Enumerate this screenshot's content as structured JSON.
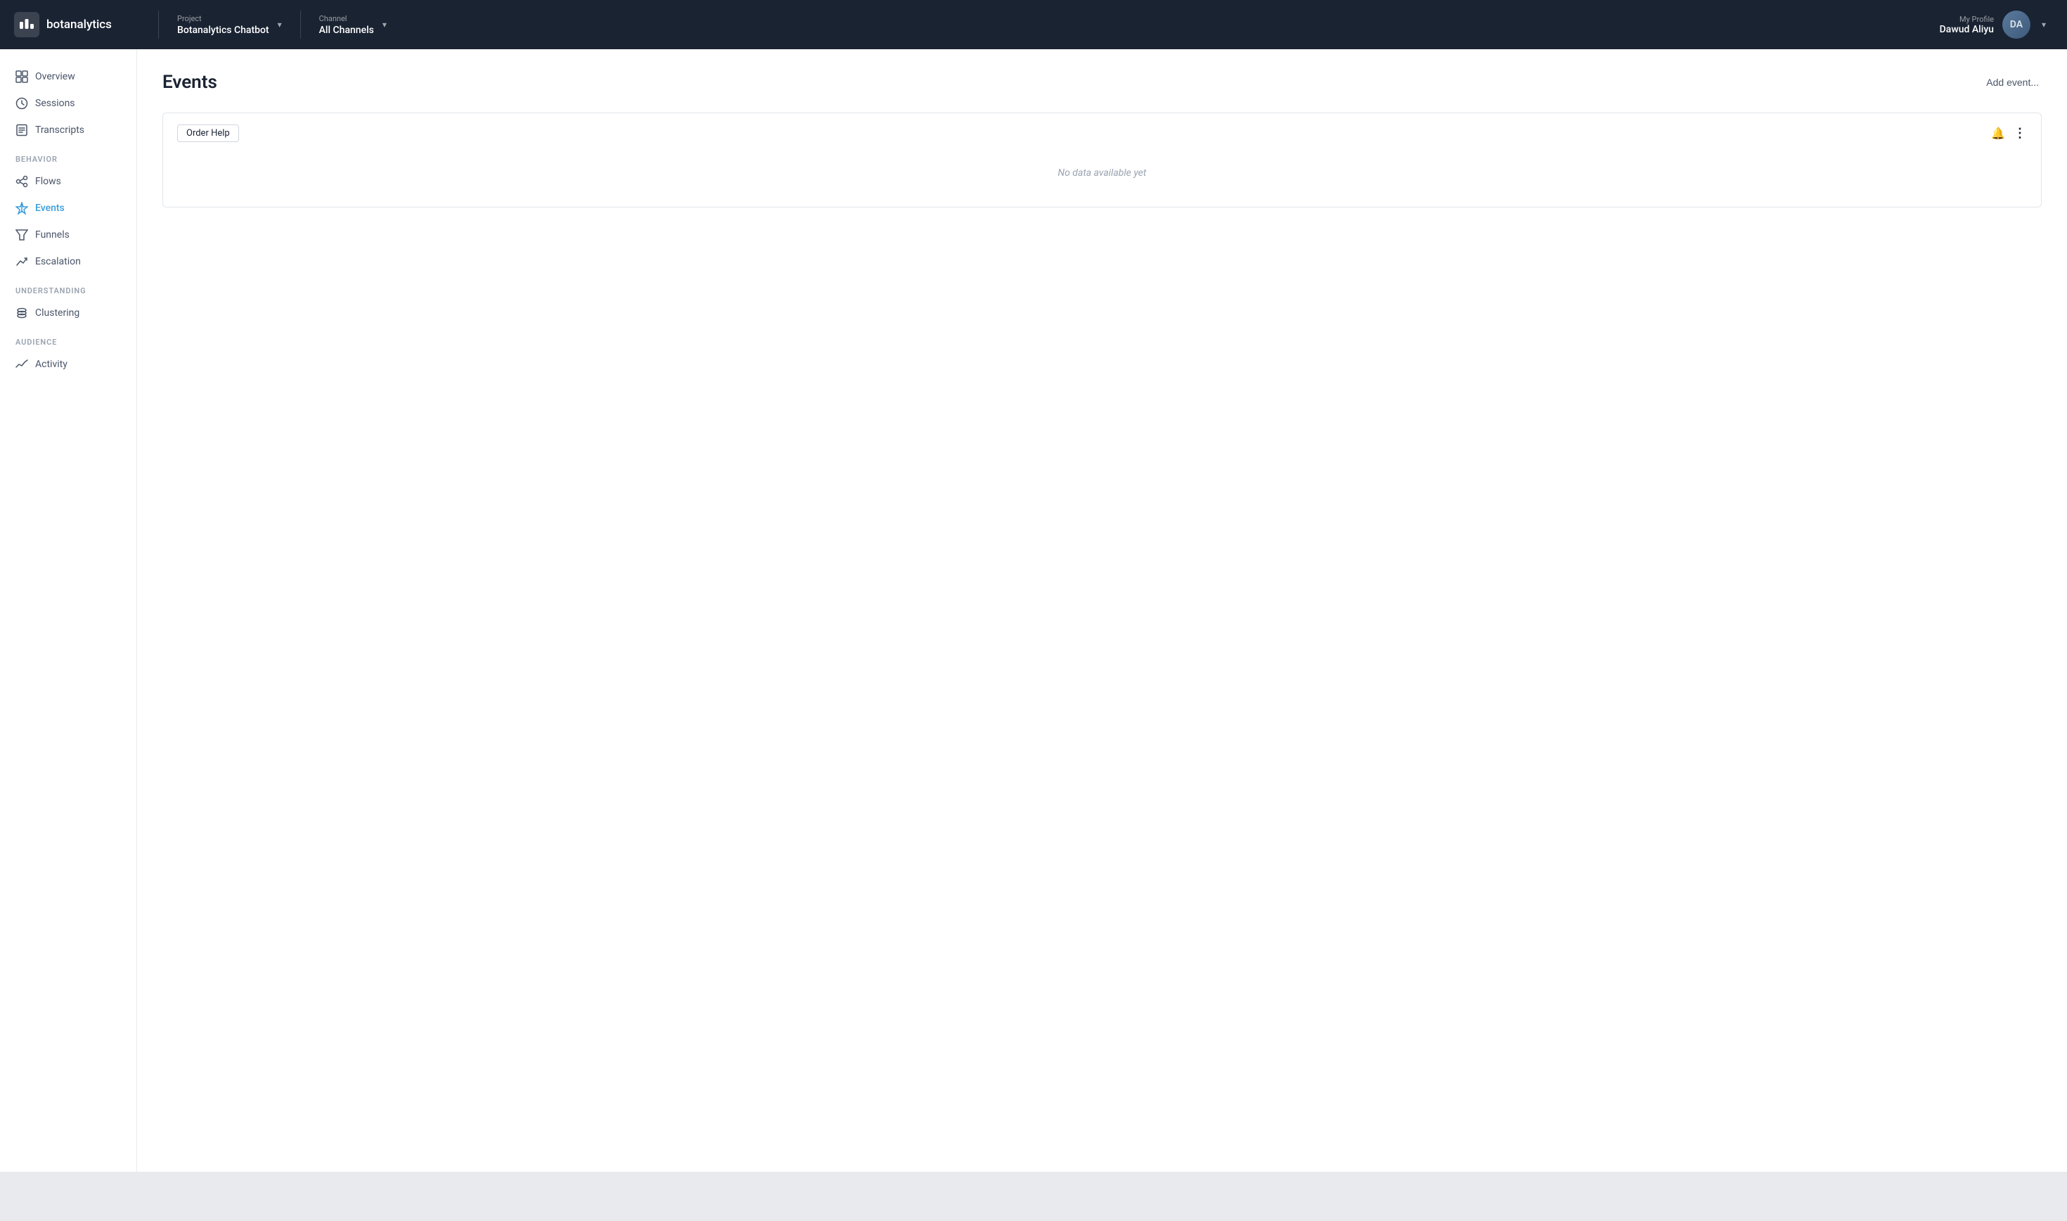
{
  "brand": {
    "name": "botanalytics"
  },
  "topnav": {
    "project_label": "Project",
    "project_value": "Botanalytics Chatbot",
    "channel_label": "Channel",
    "channel_value": "All Channels",
    "profile_label": "My Profile",
    "profile_name": "Dawud Aliyu"
  },
  "sidebar": {
    "sections": [
      {
        "items": [
          {
            "id": "overview",
            "label": "Overview"
          },
          {
            "id": "sessions",
            "label": "Sessions"
          },
          {
            "id": "transcripts",
            "label": "Transcripts"
          }
        ]
      },
      {
        "section_label": "BEHAVIOR",
        "items": [
          {
            "id": "flows",
            "label": "Flows"
          },
          {
            "id": "events",
            "label": "Events",
            "active": true
          },
          {
            "id": "funnels",
            "label": "Funnels"
          },
          {
            "id": "escalation",
            "label": "Escalation"
          }
        ]
      },
      {
        "section_label": "UNDERSTANDING",
        "items": [
          {
            "id": "clustering",
            "label": "Clustering"
          }
        ]
      },
      {
        "section_label": "AUDIENCE",
        "items": [
          {
            "id": "activity",
            "label": "Activity"
          }
        ]
      }
    ]
  },
  "main": {
    "page_title": "Events",
    "add_event_label": "Add event...",
    "event_card": {
      "tag": "Order Help",
      "no_data_text": "No data available yet"
    }
  }
}
